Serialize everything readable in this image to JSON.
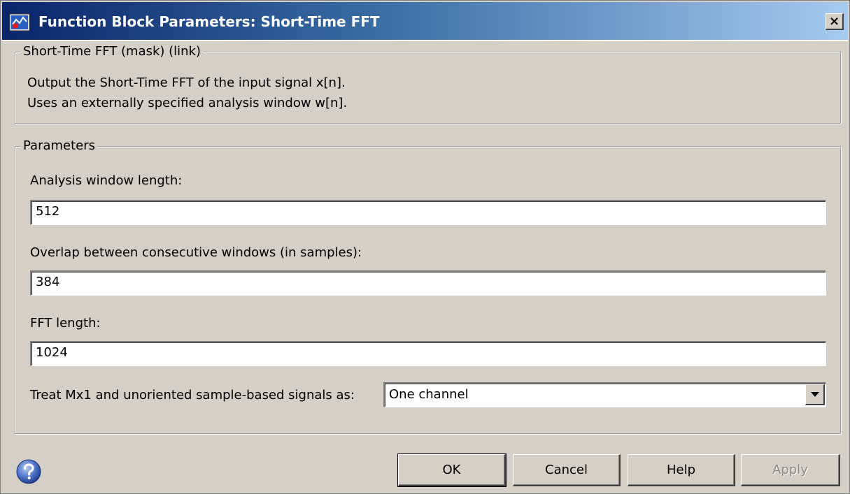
{
  "window": {
    "title": "Function Block Parameters: Short-Time FFT",
    "close_label": "×"
  },
  "mask": {
    "legend": "Short-Time FFT (mask) (link)",
    "description_lines": [
      "Output the Short-Time FFT of the input signal x[n].",
      "Uses an externally specified analysis window w[n]."
    ]
  },
  "parameters": {
    "legend": "Parameters",
    "analysis_window_length": {
      "label": "Analysis window length:",
      "value": "512"
    },
    "overlap": {
      "label": "Overlap between consecutive windows (in samples):",
      "value": "384"
    },
    "fft_length": {
      "label": "FFT length:",
      "value": "1024"
    },
    "treat_signals": {
      "label": "Treat Mx1 and unoriented sample-based signals as:",
      "selected": "One channel"
    }
  },
  "buttons": {
    "ok": "OK",
    "cancel": "Cancel",
    "help": "Help",
    "apply": "Apply"
  },
  "icons": {
    "title": "simulink-block-icon",
    "close": "close-icon",
    "help": "question-mark-icon",
    "dropdown": "chevron-down-icon"
  },
  "colors": {
    "dialog_background": "#d4d0c8",
    "titlebar_start": "#0a246a",
    "titlebar_end": "#a6caf0",
    "disabled_text": "#8c8a82"
  }
}
